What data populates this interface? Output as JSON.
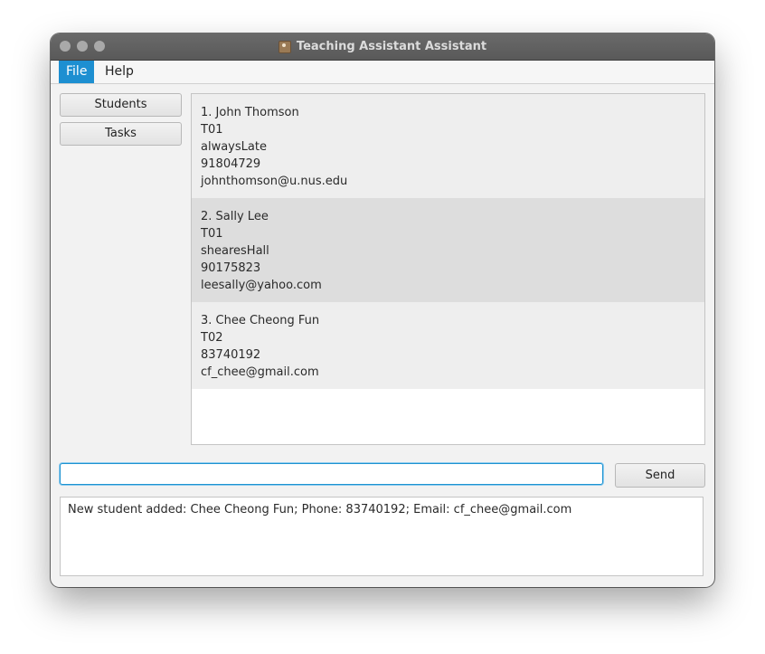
{
  "window": {
    "title": "Teaching Assistant Assistant"
  },
  "menubar": {
    "items": [
      {
        "label": "File",
        "active": true
      },
      {
        "label": "Help",
        "active": false
      }
    ]
  },
  "sidebar": {
    "buttons": [
      {
        "label": "Students"
      },
      {
        "label": "Tasks"
      }
    ]
  },
  "students": [
    {
      "lines": [
        "1.  John Thomson",
        "T01",
        "alwaysLate",
        "91804729",
        "johnthomson@u.nus.edu"
      ],
      "background": "#eeeeee"
    },
    {
      "lines": [
        "2.  Sally Lee",
        "T01",
        "shearesHall",
        "90175823",
        "leesally@yahoo.com"
      ],
      "background": "#dddddd"
    },
    {
      "lines": [
        "3.  Chee Cheong Fun",
        "T02",
        "83740192",
        "cf_chee@gmail.com"
      ],
      "background": "#eeeeee"
    }
  ],
  "command": {
    "value": "",
    "send_label": "Send"
  },
  "result": {
    "text": "New student added: Chee Cheong Fun; Phone: 83740192; Email: cf_chee@gmail.com"
  },
  "colors": {
    "accent": "#1d8fd1",
    "titlebar": "#5f5f5f",
    "window_bg": "#f2f2f2"
  }
}
